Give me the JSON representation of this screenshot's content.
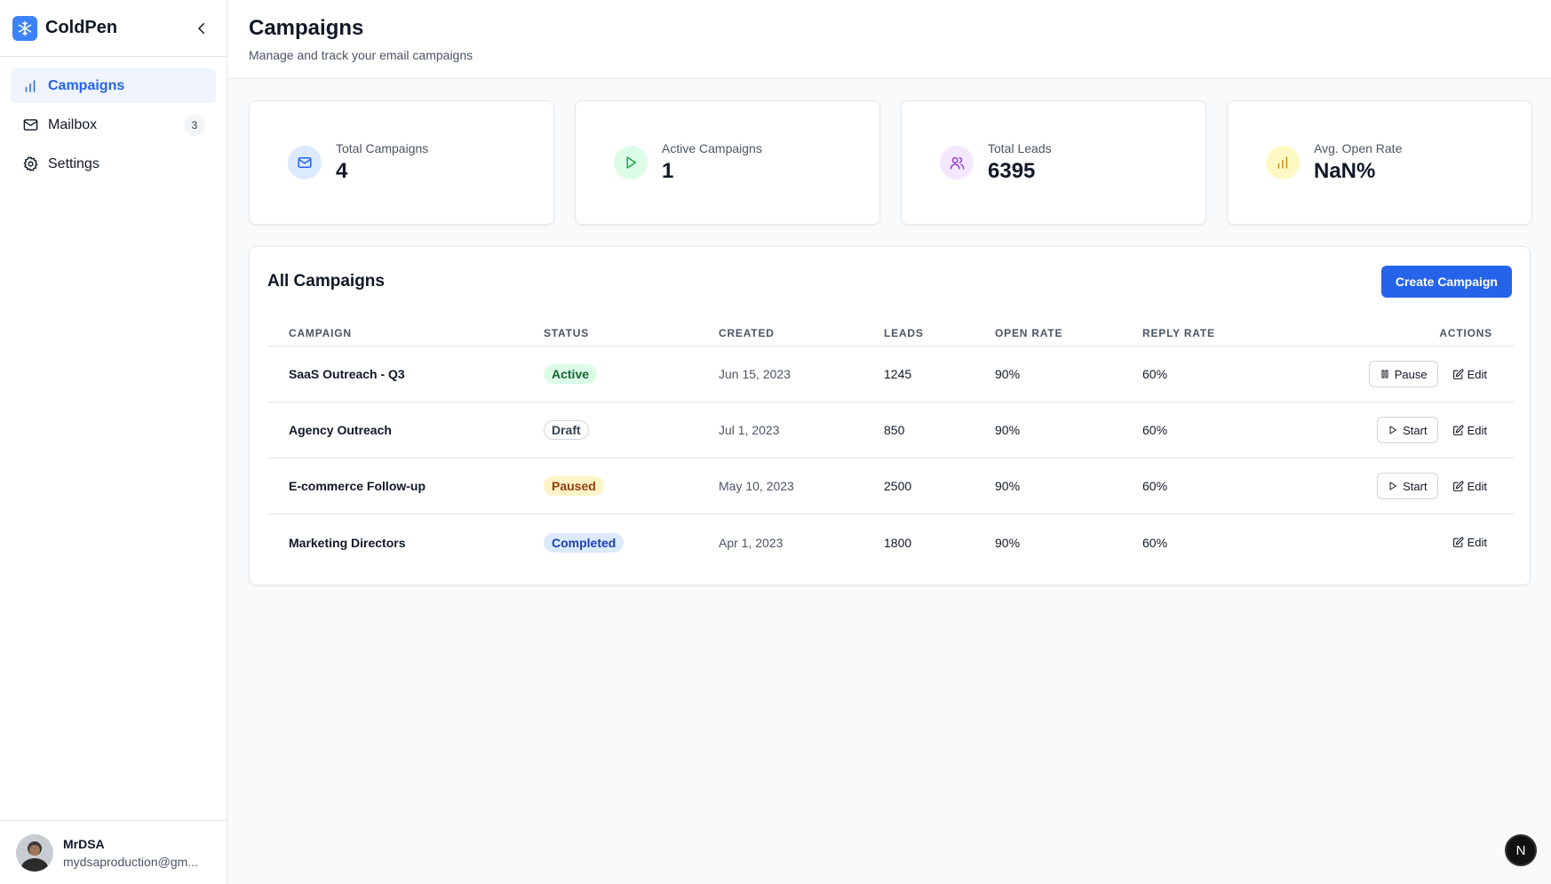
{
  "app": {
    "name": "ColdPen",
    "logo_icon": "snowflake-icon",
    "accent": "#2563eb"
  },
  "sidebar": {
    "items": [
      {
        "label": "Campaigns",
        "icon": "bar-chart-icon",
        "active": true
      },
      {
        "label": "Mailbox",
        "icon": "mail-icon",
        "badge": "3"
      },
      {
        "label": "Settings",
        "icon": "gear-icon"
      }
    ],
    "user": {
      "name": "MrDSA",
      "email": "mydsaproduction@gm..."
    }
  },
  "header": {
    "title": "Campaigns",
    "subtitle": "Manage and track your email campaigns"
  },
  "stats": [
    {
      "label": "Total Campaigns",
      "value": "4",
      "icon": "mail-icon",
      "color": "#2563eb",
      "bg": "#dbeafe"
    },
    {
      "label": "Active Campaigns",
      "value": "1",
      "icon": "play-icon",
      "color": "#16a34a",
      "bg": "#dcfce7"
    },
    {
      "label": "Total Leads",
      "value": "6395",
      "icon": "users-icon",
      "color": "#9333ea",
      "bg": "#f3e8ff"
    },
    {
      "label": "Avg. Open Rate",
      "value": "NaN%",
      "icon": "bar-chart-icon",
      "color": "#ca8a04",
      "bg": "#fef9c3"
    }
  ],
  "table": {
    "title": "All Campaigns",
    "create_label": "Create Campaign",
    "columns": [
      "CAMPAIGN",
      "STATUS",
      "CREATED",
      "LEADS",
      "OPEN RATE",
      "REPLY RATE",
      "ACTIONS"
    ],
    "rows": [
      {
        "name": "SaaS Outreach - Q3",
        "status": "Active",
        "created": "Jun 15, 2023",
        "leads": "1245",
        "open_rate": "90%",
        "reply_rate": "60%",
        "primary_action": "Pause",
        "edit": "Edit"
      },
      {
        "name": "Agency Outreach",
        "status": "Draft",
        "created": "Jul 1, 2023",
        "leads": "850",
        "open_rate": "90%",
        "reply_rate": "60%",
        "primary_action": "Start",
        "edit": "Edit"
      },
      {
        "name": "E-commerce Follow-up",
        "status": "Paused",
        "created": "May 10, 2023",
        "leads": "2500",
        "open_rate": "90%",
        "reply_rate": "60%",
        "primary_action": "Start",
        "edit": "Edit"
      },
      {
        "name": "Marketing Directors",
        "status": "Completed",
        "created": "Apr 1, 2023",
        "leads": "1800",
        "open_rate": "90%",
        "reply_rate": "60%",
        "primary_action": "",
        "edit": "Edit"
      }
    ]
  },
  "floating_badge": "N"
}
